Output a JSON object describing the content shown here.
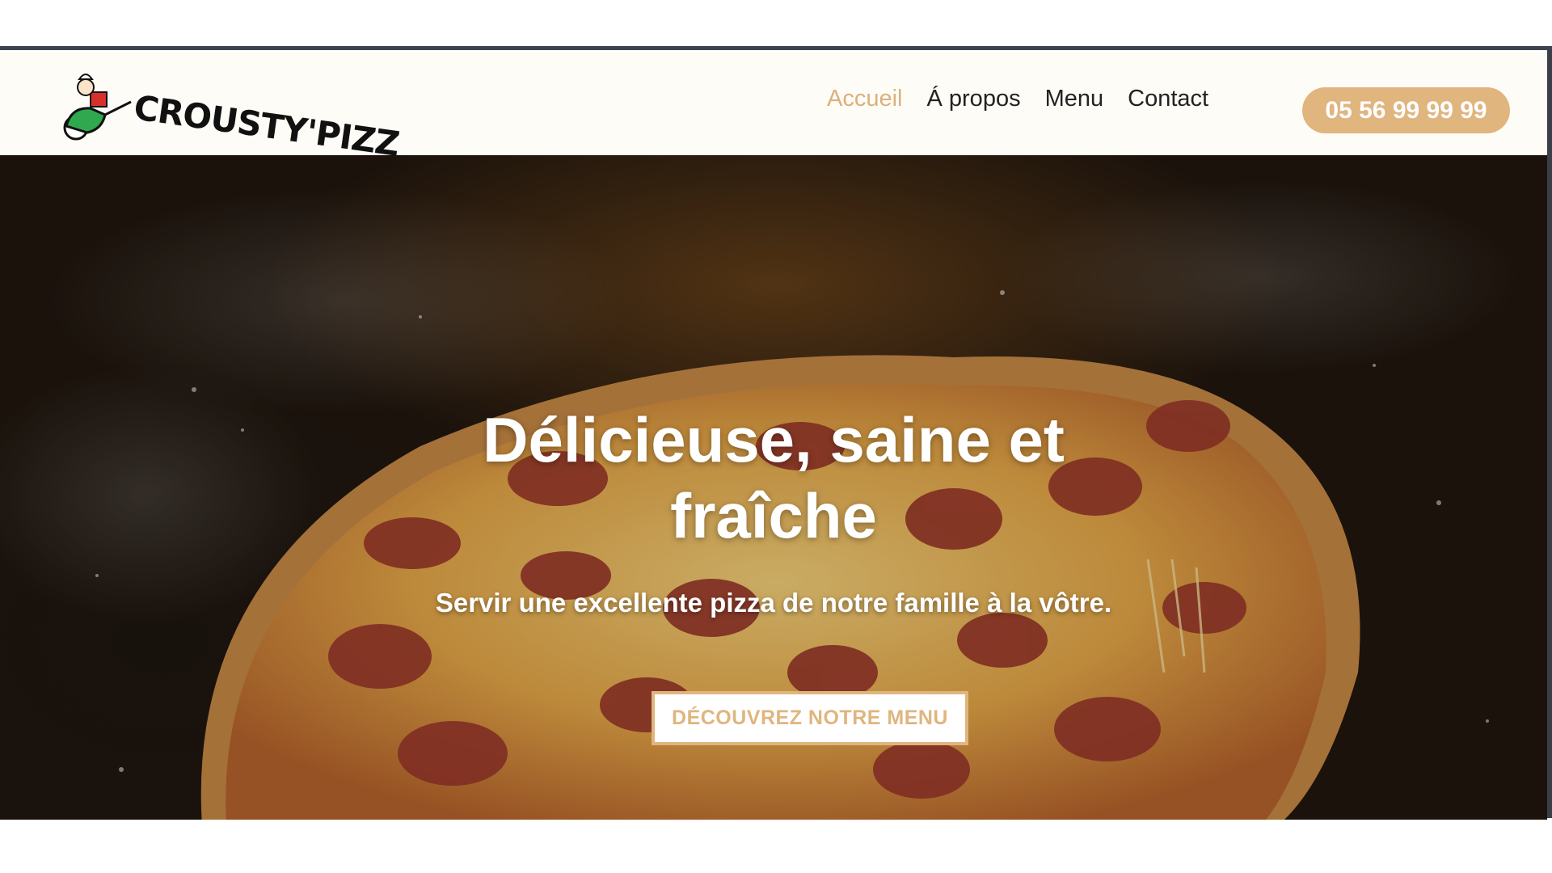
{
  "header": {
    "logo_text": "CROUSTY'PIZZ",
    "nav": [
      {
        "label": "Accueil",
        "active": true
      },
      {
        "label": "Á propos",
        "active": false
      },
      {
        "label": "Menu",
        "active": false
      },
      {
        "label": "Contact",
        "active": false
      }
    ],
    "phone": "05 56 99 99 99"
  },
  "hero": {
    "title_line1": "Délicieuse, saine et",
    "title_line2": "fraîche",
    "subtitle": "Servir une excellente pizza de notre famille à la vôtre.",
    "cta_label": "DÉCOUVREZ NOTRE MENU"
  },
  "colors": {
    "accent": "#e0b57e",
    "header_bg": "#fefcf6",
    "hero_bg": "#21170f",
    "nav_text": "#222222"
  }
}
